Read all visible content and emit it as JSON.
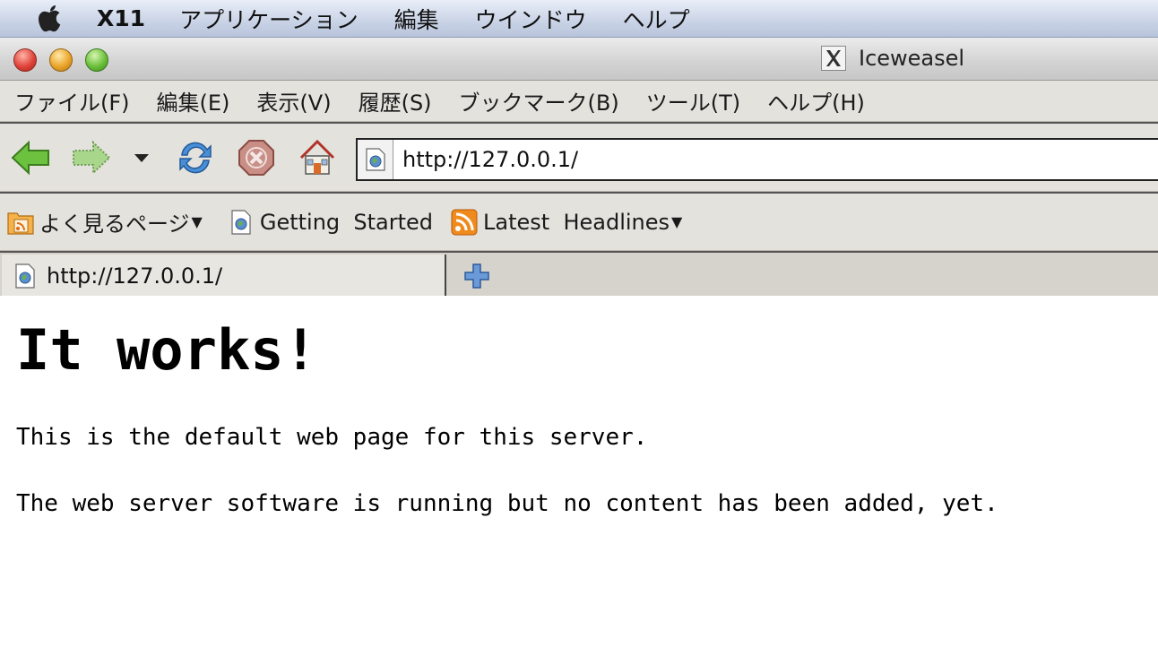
{
  "mac_menubar": {
    "items": [
      "X11",
      "アプリケーション",
      "編集",
      "ウインドウ",
      "ヘルプ"
    ]
  },
  "window": {
    "title": "Iceweasel"
  },
  "app_menu": {
    "items": [
      "ファイル(F)",
      "編集(E)",
      "表示(V)",
      "履歴(S)",
      "ブックマーク(B)",
      "ツール(T)",
      "ヘルプ(H)"
    ]
  },
  "navbar": {
    "url": "http://127.0.0.1/"
  },
  "bookmarks": {
    "items": [
      {
        "label": "よく見るページ",
        "icon": "folder-rss-icon",
        "dropdown": true
      },
      {
        "label": "Getting  Started",
        "icon": "page-icon",
        "dropdown": false
      },
      {
        "label": "Latest  Headlines",
        "icon": "rss-icon",
        "dropdown": true
      }
    ]
  },
  "tabs": {
    "active_label": "http://127.0.0.1/"
  },
  "page": {
    "heading": "It works!",
    "paragraph1": "This is the default web page for this server.",
    "paragraph2": "The web server software is running but no content has been added, yet."
  },
  "colors": {
    "accent_back": "#5db33a",
    "rss": "#f08a1c"
  }
}
